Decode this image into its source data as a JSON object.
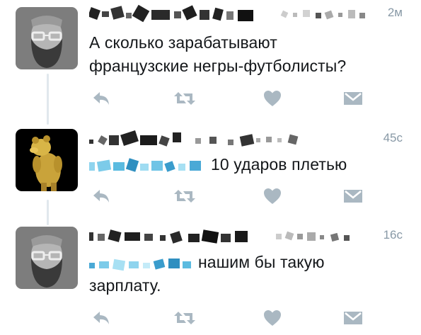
{
  "tweets": [
    {
      "time": "2м",
      "text_lines": [
        "А сколько зарабатывают",
        "французские негры-футболисты?"
      ],
      "avatar": "bearded-man-with-glasses"
    },
    {
      "time": "45с",
      "text": "10 ударов плетью",
      "avatar": "yellow-bear-figurine"
    },
    {
      "time": "16с",
      "text_lines": [
        "нашим бы такую",
        "зарплату."
      ],
      "avatar": "bearded-man-with-glasses"
    }
  ],
  "action_icons": [
    "reply-icon",
    "retweet-icon",
    "like-heart-icon",
    "direct-message-icon"
  ],
  "colors": {
    "icon": "#aab8c2",
    "time": "#8899a6",
    "text": "#14171a",
    "thread_line": "#e1e8ed",
    "mention_redacted": "#8fd4ee"
  }
}
